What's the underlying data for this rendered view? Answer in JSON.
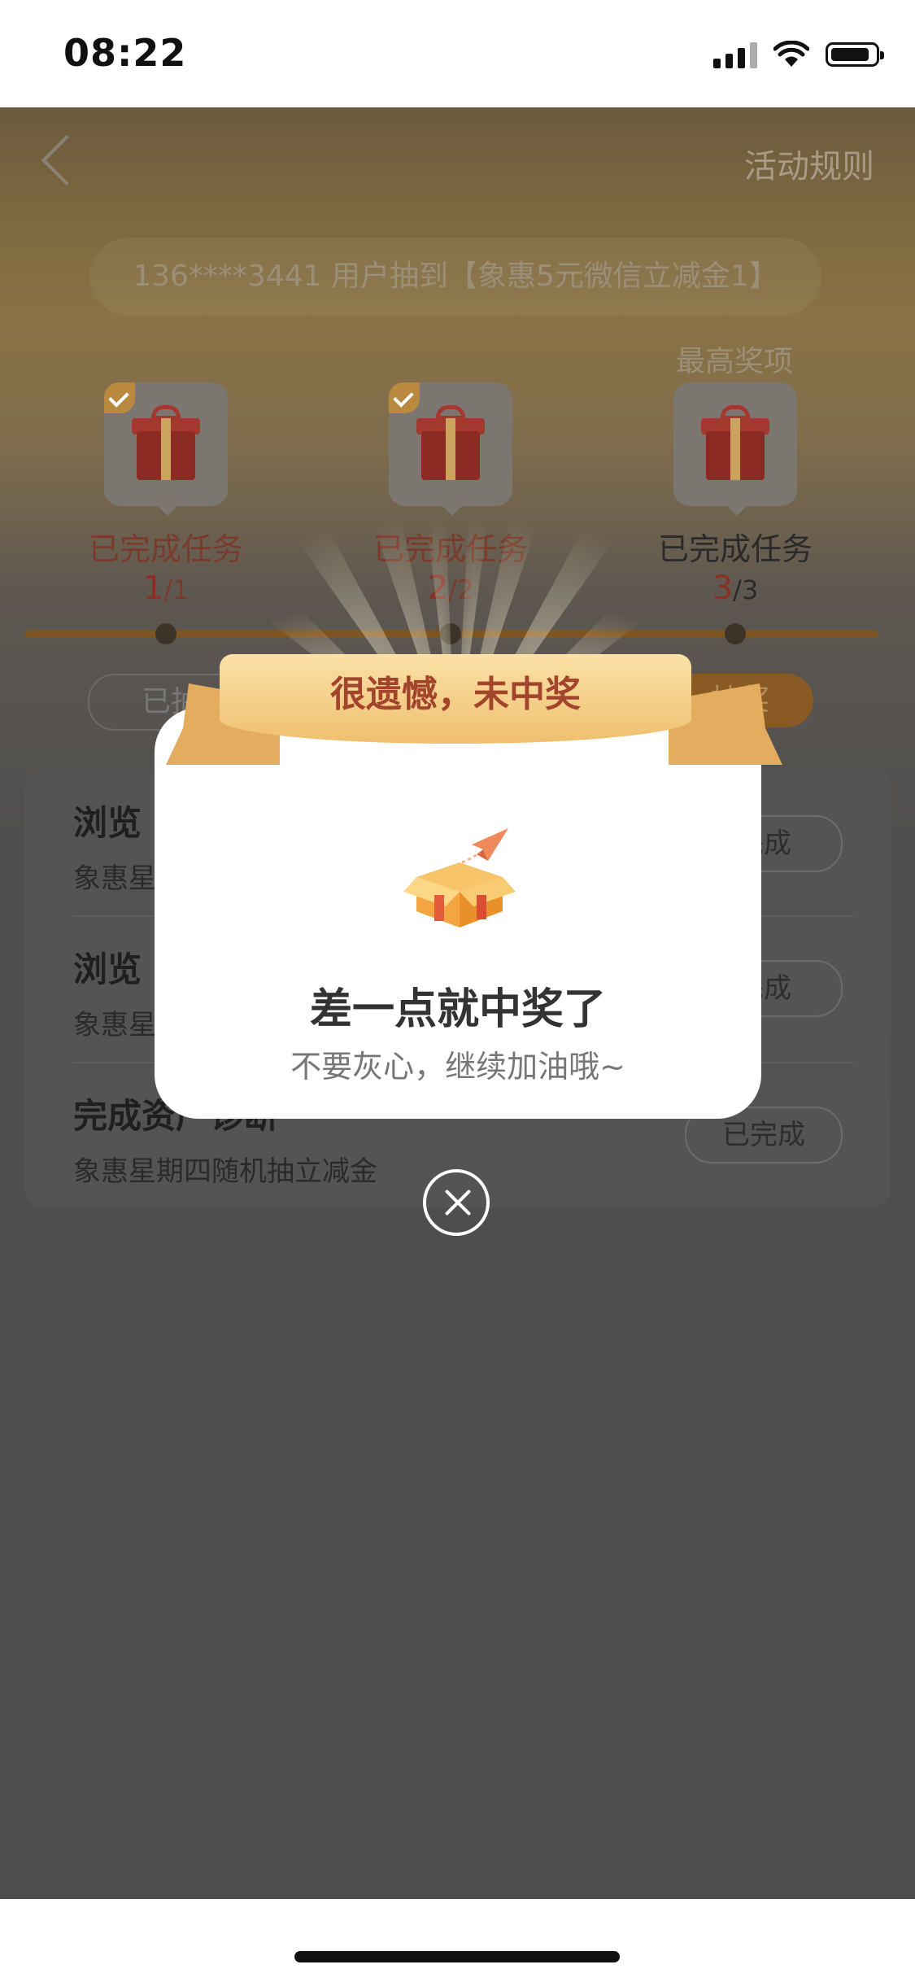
{
  "status_bar": {
    "time": "08:22"
  },
  "header": {
    "rules_label": "活动规则"
  },
  "ticker": {
    "text": "136****3441 用户抽到【象惠5元微信立减金1】"
  },
  "milestones": {
    "top_prize_label": "最高奖项",
    "items": [
      {
        "label": "已完成任务",
        "done": "1",
        "total": "/1",
        "checked": true
      },
      {
        "label": "已完成任务",
        "done": "2",
        "total": "/2",
        "checked": true
      },
      {
        "label": "已完成任务",
        "done": "3",
        "total": "/3",
        "checked": false
      }
    ]
  },
  "tabs": {
    "left": "已抽",
    "right": "抽奖"
  },
  "tasks": [
    {
      "title": "浏览",
      "subtitle": "象惠星",
      "button": "完成"
    },
    {
      "title": "浏览",
      "subtitle": "象惠星",
      "button": "完成"
    },
    {
      "title": "完成资产诊断",
      "subtitle": "象惠星期四随机抽立减金",
      "button": "已完成"
    }
  ],
  "modal": {
    "ribbon_text": "很遗憾，未中奖",
    "title": "差一点就中奖了",
    "subtitle": "不要灰心，继续加油哦~"
  },
  "colors": {
    "accent_red": "#a3452d",
    "ribbon_gold": "#efbf6e",
    "overlay": "#4d4d4d"
  }
}
